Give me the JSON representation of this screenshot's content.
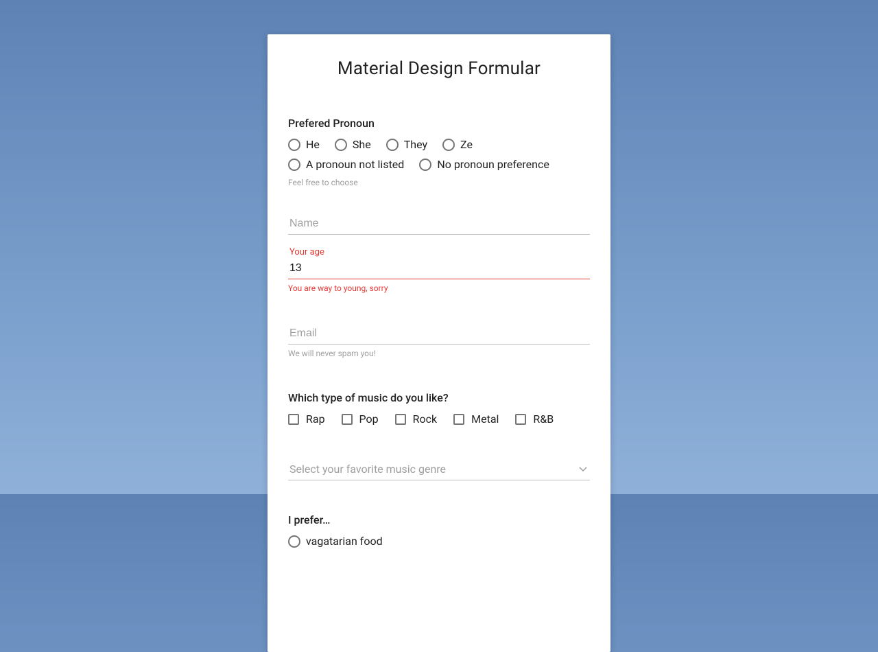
{
  "title": "Material Design Formular",
  "pronoun": {
    "label": "Prefered Pronoun",
    "options": [
      "He",
      "She",
      "They",
      "Ze",
      "A pronoun not listed",
      "No pronoun preference"
    ],
    "hint": "Feel free to choose"
  },
  "name": {
    "placeholder": "Name",
    "value": ""
  },
  "age": {
    "label": "Your age",
    "value": "13",
    "error": "You are way to young, sorry"
  },
  "email": {
    "placeholder": "Email",
    "value": "",
    "hint": "We will never spam you!"
  },
  "music_checkbox": {
    "label": "Which type of music do you like?",
    "options": [
      "Rap",
      "Pop",
      "Rock",
      "Metal",
      "R&B"
    ]
  },
  "music_select": {
    "placeholder": "Select your favorite music genre"
  },
  "diet": {
    "label": "I prefer…",
    "options": [
      "vagatarian food"
    ]
  }
}
